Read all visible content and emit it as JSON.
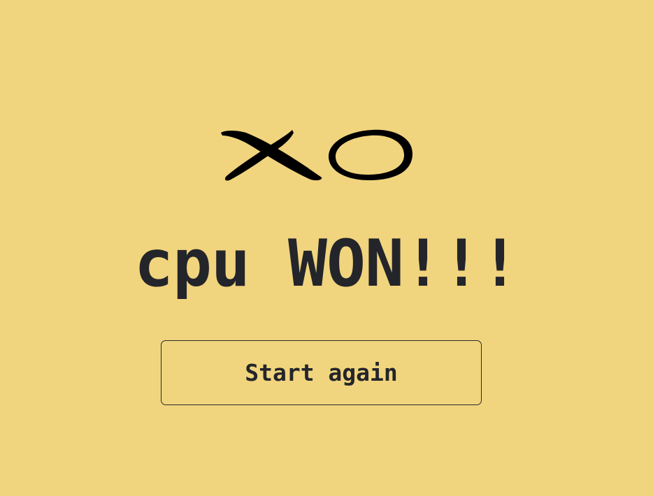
{
  "logo": {
    "icon": "xo-logo-icon",
    "letters": "XO",
    "color": "#000000"
  },
  "result": {
    "text": "cpu WON!!!"
  },
  "restart_button": {
    "label": "Start again"
  },
  "colors": {
    "background": "#f1d47e",
    "text": "#23252a",
    "button_border": "#2b2b2b"
  }
}
